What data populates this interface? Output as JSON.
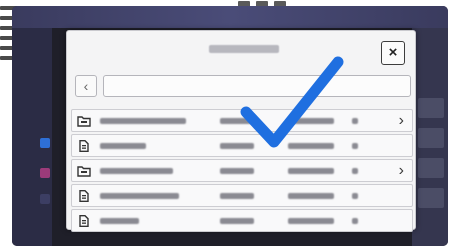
{
  "dialog": {
    "title": "",
    "close_label": "×",
    "back_label": "‹",
    "path_value": ""
  },
  "rows": [
    {
      "type": "folder",
      "icon": "folder-icon",
      "name": "",
      "has_chevron": true,
      "name_length": 0.78
    },
    {
      "type": "file",
      "icon": "file-icon",
      "name": "",
      "has_chevron": false,
      "name_length": 0.42
    },
    {
      "type": "folder",
      "icon": "folder-icon",
      "name": "",
      "has_chevron": true,
      "name_length": 0.66
    },
    {
      "type": "file",
      "icon": "file-icon",
      "name": "",
      "has_chevron": false,
      "name_length": 0.72
    },
    {
      "type": "file",
      "icon": "file-icon",
      "name": "",
      "has_chevron": false,
      "name_length": 0.35
    }
  ],
  "chevron_glyph": "›",
  "overlay": {
    "icon": "checkmark-icon",
    "color": "#1f6fe0"
  },
  "colors": {
    "device": "#1f1f29",
    "accent": "#1f6fe0"
  }
}
